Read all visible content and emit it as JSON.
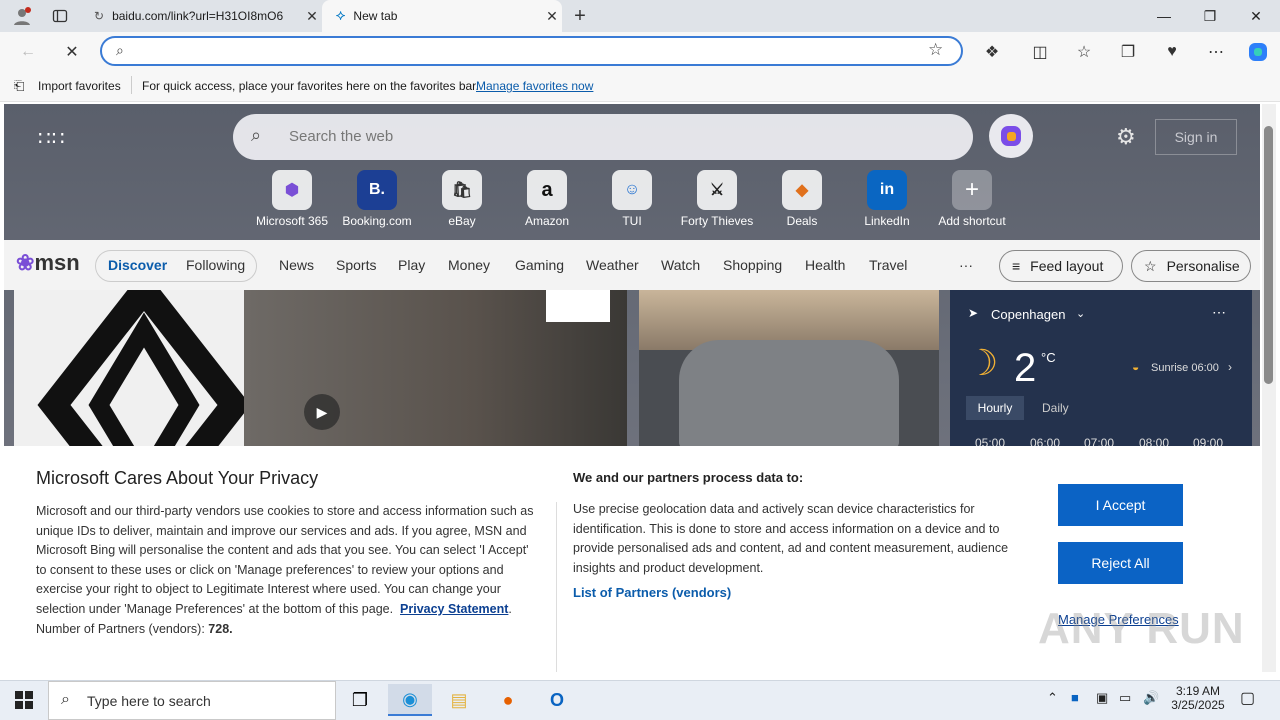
{
  "browser": {
    "tabs": [
      {
        "title": "baidu.com/link?url=H31OI8mO6"
      },
      {
        "title": "New tab"
      }
    ],
    "address_bar": {
      "value": "",
      "placeholder": ""
    }
  },
  "favorites_bar": {
    "import_label": "Import favorites",
    "hint_text": "For quick access, place your favorites here on the favorites bar.",
    "manage_link": "Manage favorites now"
  },
  "newtab": {
    "search_placeholder": "Search the web",
    "sign_in": "Sign in",
    "shortcuts": [
      {
        "label": "Microsoft 365",
        "icon": "m365-icon"
      },
      {
        "label": "Booking.com",
        "icon": "booking-icon"
      },
      {
        "label": "eBay",
        "icon": "ebay-icon"
      },
      {
        "label": "Amazon",
        "icon": "amazon-icon"
      },
      {
        "label": "TUI",
        "icon": "tui-icon"
      },
      {
        "label": "Forty Thieves",
        "icon": "forty-thieves-icon"
      },
      {
        "label": "Deals",
        "icon": "deals-icon"
      },
      {
        "label": "LinkedIn",
        "icon": "linkedin-icon"
      },
      {
        "label": "Add shortcut",
        "icon": "plus-icon"
      }
    ],
    "msn": {
      "logo": "msn",
      "tabs": [
        "Discover",
        "Following"
      ],
      "nav": [
        "News",
        "Sports",
        "Play",
        "Money",
        "Gaming",
        "Weather",
        "Watch",
        "Shopping",
        "Health",
        "Travel"
      ],
      "more": "···",
      "feed_layout": "Feed layout",
      "personalise": "Personalise"
    },
    "weather": {
      "location": "Copenhagen",
      "temp": "2",
      "unit": "°C",
      "sunrise": "Sunrise 06:00",
      "tabs": [
        "Hourly",
        "Daily"
      ],
      "hours": [
        "05:00",
        "06:00",
        "07:00",
        "08:00",
        "09:00"
      ]
    }
  },
  "privacy": {
    "title": "Microsoft Cares About Your Privacy",
    "body": "Microsoft and our third-party vendors use cookies to store and access information such as unique IDs to deliver, maintain and improve our services and ads. If you agree, MSN and Microsoft Bing will personalise the content and ads that you see. You can select 'I Accept' to consent to these uses or click on 'Manage preferences' to review your options and exercise your right to object to Legitimate Interest where used.  You can change your selection under 'Manage Preferences' at the bottom of this page.",
    "policy_link": "Privacy Statement",
    "partners_count_label": "Number of Partners (vendors):",
    "partners_count": "728.",
    "purposes_title": "We and our partners process data to:",
    "purposes_body": "Use precise geolocation data and actively scan device characteristics for identification. This is done to store and access information on a device and to provide personalised ads and content, ad and content measurement, audience insights and product development.",
    "partners_link": "List of Partners (vendors)",
    "accept": "I Accept",
    "reject": "Reject All",
    "manage": "Manage Preferences"
  },
  "taskbar": {
    "search_placeholder": "Type here to search",
    "time": "3:19 AM",
    "date": "3/25/2025"
  },
  "watermark": "ANY RUN"
}
